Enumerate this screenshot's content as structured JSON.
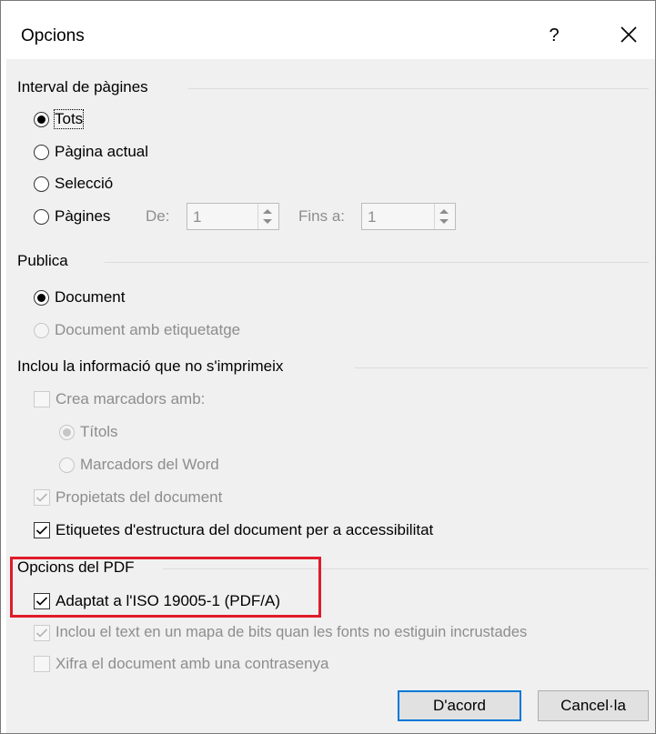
{
  "window": {
    "title": "Opcions",
    "help_glyph": "?",
    "close_icon": "close-icon"
  },
  "page_range": {
    "title": "Interval de pàgines",
    "all": "Tots",
    "current": "Pàgina actual",
    "selection": "Selecció",
    "pages": "Pàgines",
    "from_label": "De:",
    "from_value": "1",
    "to_label": "Fins a:",
    "to_value": "1",
    "selected": "Tots"
  },
  "publish": {
    "title": "Publica",
    "document": "Document",
    "document_tags": "Document amb etiquetatge",
    "selected": "Document"
  },
  "nonprint": {
    "title": "Inclou la informació que no s'imprimeix",
    "bookmarks": "Crea marcadors amb:",
    "headings": "Títols",
    "word_bookmarks": "Marcadors del Word",
    "properties": "Propietats del document",
    "structure_tags": "Etiquetes d'estructura del document per a accessibilitat"
  },
  "pdf_options": {
    "title": "Opcions del PDF",
    "iso": "Adaptat a l'ISO 19005-1 (PDF/A)",
    "bitmap": "Inclou el text en un mapa de bits quan les fonts no estiguin incrustades",
    "encrypt": "Xifra el document amb una contrasenya"
  },
  "buttons": {
    "ok": "D'acord",
    "cancel": "Cancel·la"
  },
  "colors": {
    "highlight": "#e11b2b",
    "default_button_border": "#0078d7"
  }
}
